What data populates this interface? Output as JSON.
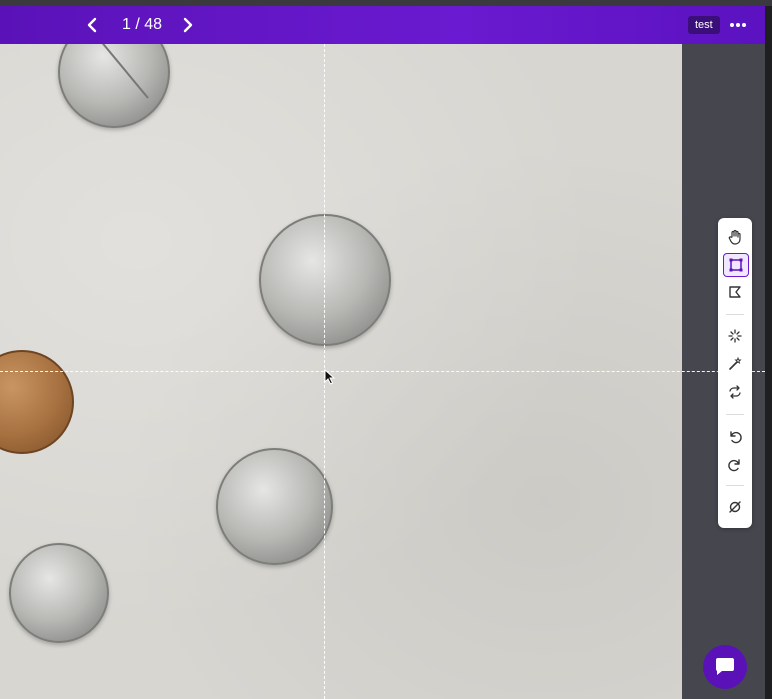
{
  "header": {
    "page_current": "1",
    "page_total": "48",
    "page_separator": "/",
    "project_tag": "test",
    "prev_icon": "chevron-left-icon",
    "next_icon": "chevron-right-icon",
    "more_icon": "more-horizontal-icon"
  },
  "toolbar": {
    "tools": [
      {
        "name": "pan",
        "icon": "hand-icon",
        "active": false
      },
      {
        "name": "bounding-box",
        "icon": "bounding-box-icon",
        "active": true
      },
      {
        "name": "polygon",
        "icon": "polygon-icon",
        "active": false
      },
      {
        "name": "smart-select",
        "icon": "smart-select-icon",
        "active": false
      },
      {
        "name": "magic-wand",
        "icon": "magic-wand-icon",
        "active": false
      },
      {
        "name": "repeat",
        "icon": "repeat-icon",
        "active": false
      },
      {
        "name": "undo",
        "icon": "undo-icon",
        "active": false
      },
      {
        "name": "redo",
        "icon": "redo-icon",
        "active": false
      },
      {
        "name": "null-annotation",
        "icon": "null-icon",
        "active": false
      }
    ]
  },
  "colors": {
    "brand": "#5a12b8",
    "toolbar_bg": "#ffffff",
    "sidepanel": "#46464f",
    "canvas": "#d8d6d1"
  },
  "chat_icon": "chat-bubble-icon"
}
